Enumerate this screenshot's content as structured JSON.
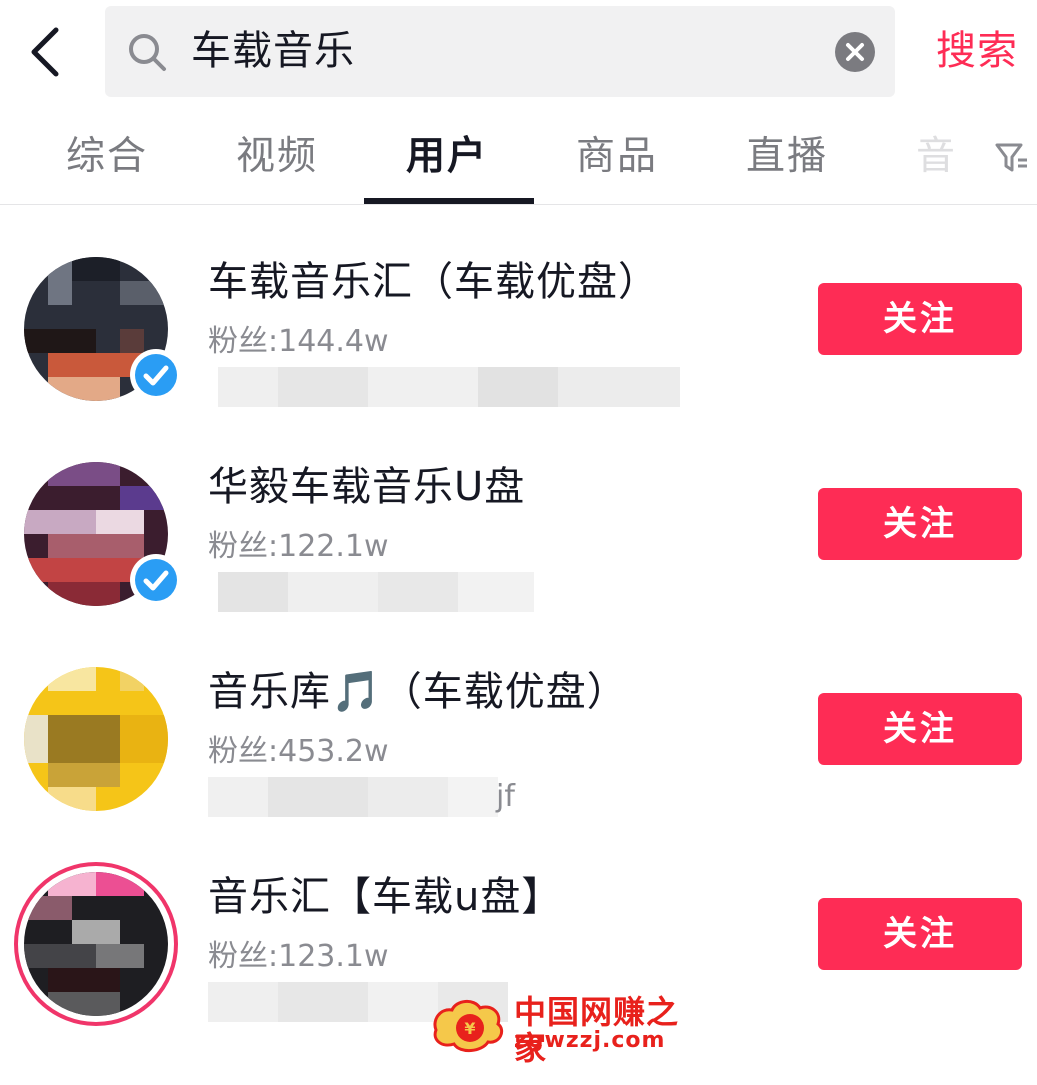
{
  "search": {
    "query": "车载音乐",
    "button_label": "搜索"
  },
  "tabs": [
    {
      "label": "综合"
    },
    {
      "label": "视频"
    },
    {
      "label": "用户"
    },
    {
      "label": "商品"
    },
    {
      "label": "直播"
    },
    {
      "label": "音"
    }
  ],
  "active_tab": "用户",
  "users": [
    {
      "name": "车载音乐汇（车载优盘）",
      "fans": "粉丝:144.4w",
      "verified": true,
      "follow_label": "关注"
    },
    {
      "name": "华毅车载音乐U盘",
      "fans": "粉丝:122.1w",
      "verified": true,
      "follow_label": "关注"
    },
    {
      "name": "音乐库🎵（车载优盘）",
      "fans": "粉丝:453.2w",
      "verified": false,
      "follow_label": "关注",
      "desc_tail": "jf"
    },
    {
      "name": "音乐汇【车载u盘】",
      "fans": "粉丝:123.1w",
      "verified": false,
      "follow_label": "关注"
    }
  ],
  "watermark": {
    "cn": "中国网赚之家",
    "en": "zgwzzj.com"
  },
  "colors": {
    "accent": "#fe2c55",
    "verified": "#2a9df4",
    "text_primary": "#161823",
    "text_secondary": "#8a8b91"
  },
  "icons": [
    "back-arrow-icon",
    "search-icon",
    "clear-icon",
    "filter-icon",
    "verified-badge-icon",
    "music-note-icon"
  ]
}
